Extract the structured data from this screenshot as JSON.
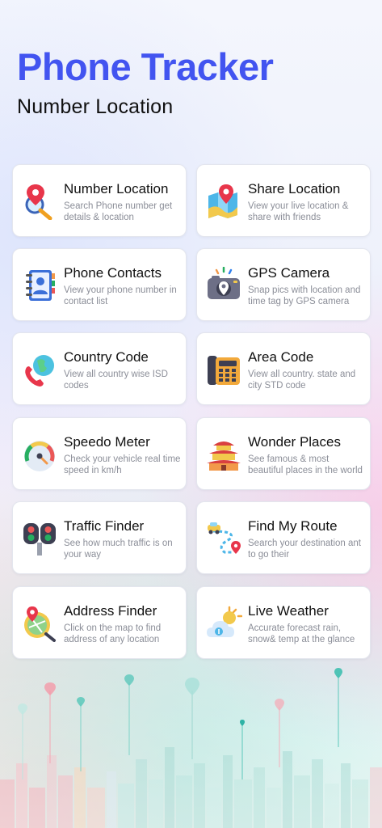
{
  "app": {
    "title": "Phone Tracker",
    "subtitle": "Number Location"
  },
  "features": [
    {
      "title": "Number Location",
      "desc": "Search Phone number get details & location",
      "icon": "search-location-icon"
    },
    {
      "title": "Share Location",
      "desc": "View your live location & share with friends",
      "icon": "map-pin-icon"
    },
    {
      "title": "Phone Contacts",
      "desc": "View your phone number in contact list",
      "icon": "contact-book-icon"
    },
    {
      "title": "GPS Camera",
      "desc": "Snap pics with location and time tag by GPS camera",
      "icon": "camera-pin-icon"
    },
    {
      "title": "Country Code",
      "desc": "View all country wise ISD codes",
      "icon": "globe-phone-icon"
    },
    {
      "title": "Area Code",
      "desc": "View all country. state and city STD code",
      "icon": "desk-phone-icon"
    },
    {
      "title": "Speedo Meter",
      "desc": "Check your vehicle real time speed in km/h",
      "icon": "speedometer-icon"
    },
    {
      "title": "Wonder Places",
      "desc": "See famous & most beautiful places in the world",
      "icon": "pagoda-icon"
    },
    {
      "title": "Traffic Finder",
      "desc": "See how much traffic is on your way",
      "icon": "traffic-light-icon"
    },
    {
      "title": "Find My Route",
      "desc": "Search your destination ant to go their",
      "icon": "route-icon"
    },
    {
      "title": "Address Finder",
      "desc": "Click on the map to find address of any location",
      "icon": "map-search-icon"
    },
    {
      "title": "Live Weather",
      "desc": "Accurate forecast rain, snow& temp at the glance",
      "icon": "weather-icon"
    }
  ],
  "colors": {
    "title_blue": "#4254f0",
    "card_border": "#e4e6ee",
    "desc_gray": "#8b8e98"
  }
}
